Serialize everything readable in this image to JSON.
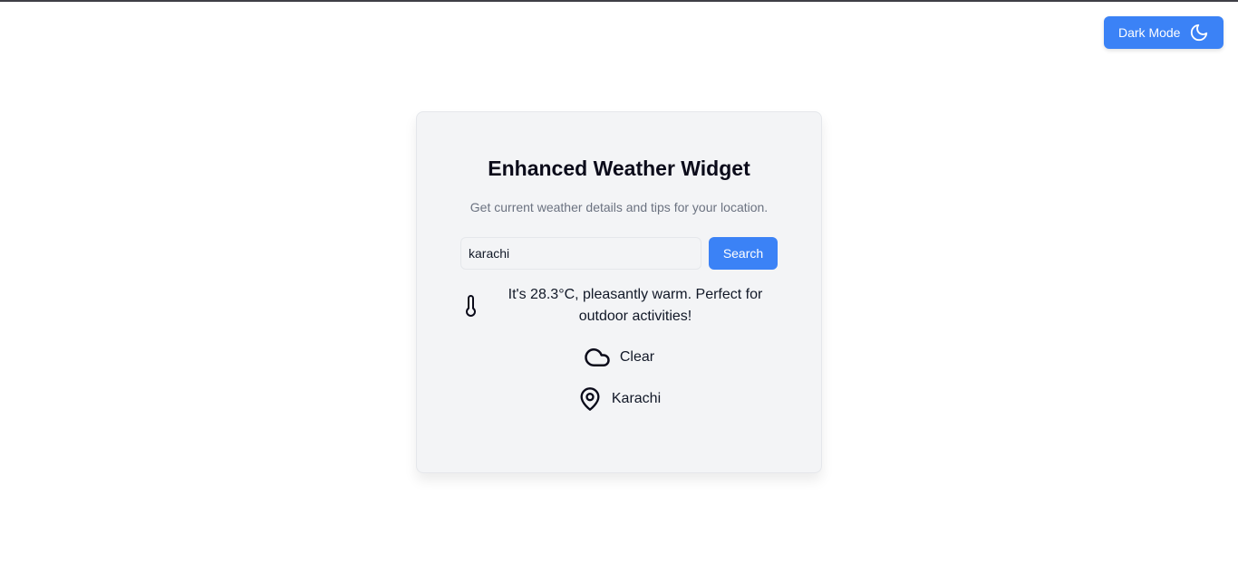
{
  "header": {
    "dark_mode_label": "Dark Mode",
    "dark_mode_icon": "moon-icon",
    "accent_color": "#3b82f6"
  },
  "widget": {
    "title": "Enhanced Weather Widget",
    "subtitle": "Get current weather details and tips for your location.",
    "search": {
      "value": "karachi",
      "placeholder": "",
      "button_label": "Search"
    },
    "tip": {
      "icon": "thermometer-icon",
      "text": "It's 28.3°C, pleasantly warm. Perfect for outdoor activities!"
    },
    "condition": {
      "icon": "cloud-icon",
      "label": "Clear"
    },
    "location": {
      "icon": "map-pin-icon",
      "label": "Karachi"
    }
  }
}
